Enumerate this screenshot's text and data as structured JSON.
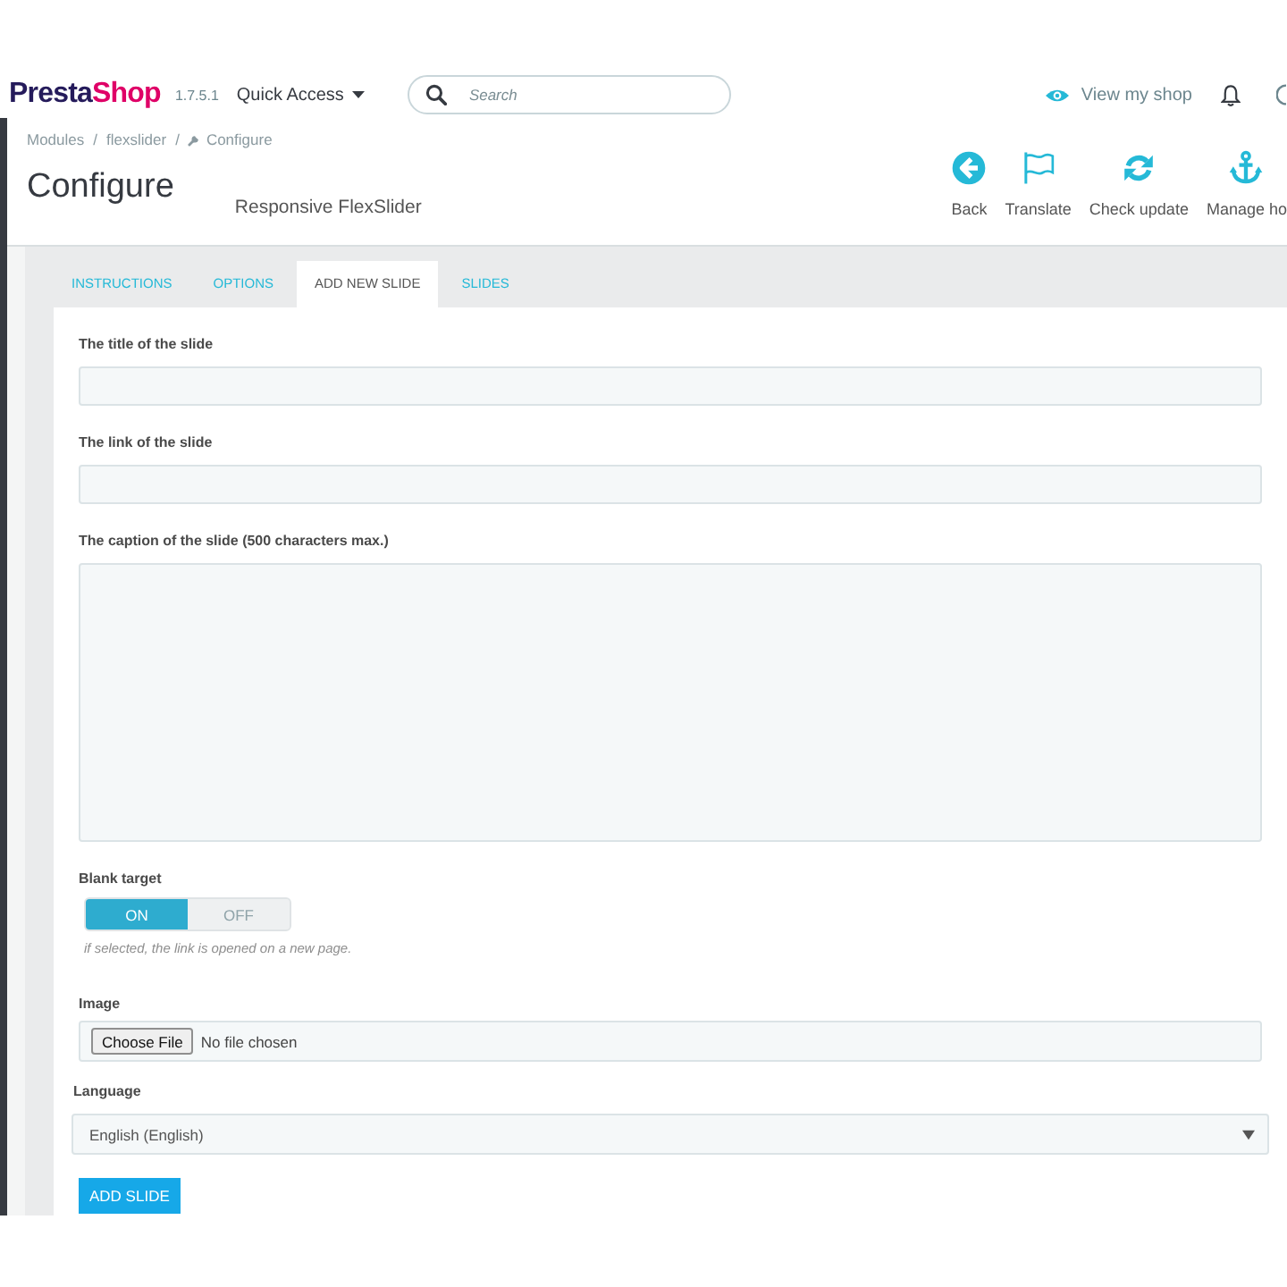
{
  "header": {
    "logo": [
      {
        "text": "Presta",
        "color": "#251b5b"
      },
      {
        "text": "Shop",
        "color": "#df0067"
      }
    ],
    "version": "1.7.5.1",
    "quick_access": "Quick Access",
    "search": {
      "placeholder": "Search"
    },
    "view_shop": "View my shop"
  },
  "breadcrumb": [
    {
      "kind": "link",
      "label": "Modules"
    },
    {
      "kind": "separator",
      "label": "/"
    },
    {
      "kind": "link",
      "label": "flexslider"
    },
    {
      "kind": "separator",
      "label": "/"
    },
    {
      "kind": "current",
      "label": "Configure"
    }
  ],
  "page_title": "Configure",
  "module_name": "Responsive FlexSlider",
  "toolbar": [
    {
      "kind": "back",
      "label": "Back"
    },
    {
      "kind": "translate",
      "label": "Translate"
    },
    {
      "kind": "refresh",
      "label": "Check update"
    },
    {
      "kind": "anchor",
      "label": "Manage ho"
    }
  ],
  "tabs": [
    {
      "label": "INSTRUCTIONS",
      "selected": false
    },
    {
      "label": "OPTIONS",
      "selected": false
    },
    {
      "label": "ADD NEW SLIDE",
      "selected": true
    },
    {
      "label": "SLIDES",
      "selected": false
    }
  ],
  "form": {
    "fields": [
      {
        "kind": "text",
        "label": "The title of the slide"
      },
      {
        "kind": "text",
        "label": "The link of the slide"
      },
      {
        "kind": "textarea",
        "label": "The caption of the slide (500 characters max.)"
      },
      {
        "kind": "switch",
        "label": "Blank target",
        "options": [
          {
            "label": "ON",
            "selected": true
          },
          {
            "label": "OFF",
            "selected": false
          }
        ],
        "help": "if selected, the link is opened on a new page."
      },
      {
        "kind": "file",
        "label": "Image",
        "button": "Choose File",
        "value": "No file chosen"
      },
      {
        "kind": "select",
        "label": "Language",
        "value": "English (English)"
      }
    ],
    "submit": "ADD SLIDE"
  }
}
